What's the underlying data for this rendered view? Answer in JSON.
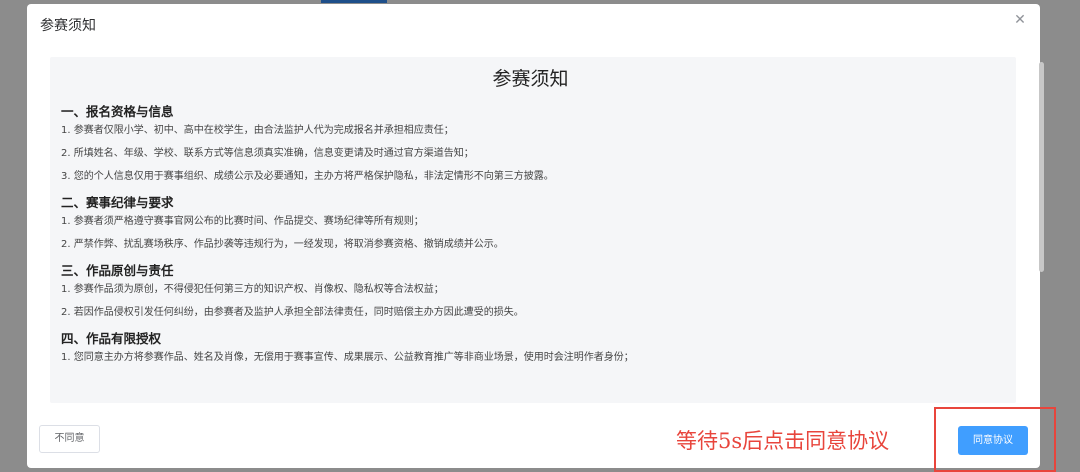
{
  "dialog": {
    "title": "参赛须知",
    "close_icon": "close-icon",
    "document": {
      "title": "参赛须知",
      "sections": [
        {
          "heading": "一、报名资格与信息",
          "items": [
            "1. 参赛者仅限小学、初中、高中在校学生，由合法监护人代为完成报名并承担相应责任；",
            "2. 所填姓名、年级、学校、联系方式等信息须真实准确，信息变更请及时通过官方渠道告知；",
            "3. 您的个人信息仅用于赛事组织、成绩公示及必要通知，主办方将严格保护隐私，非法定情形不向第三方披露。"
          ]
        },
        {
          "heading": "二、赛事纪律与要求",
          "items": [
            "1. 参赛者须严格遵守赛事官网公布的比赛时间、作品提交、赛场纪律等所有规则；",
            "2. 严禁作弊、扰乱赛场秩序、作品抄袭等违规行为，一经发现，将取消参赛资格、撤销成绩并公示。"
          ]
        },
        {
          "heading": "三、作品原创与责任",
          "items": [
            "1. 参赛作品须为原创，不得侵犯任何第三方的知识产权、肖像权、隐私权等合法权益；",
            "2. 若因作品侵权引发任何纠纷，由参赛者及监护人承担全部法律责任，同时赔偿主办方因此遭受的损失。"
          ]
        },
        {
          "heading": "四、作品有限授权",
          "items": [
            "1. 您同意主办方将参赛作品、姓名及肖像，无偿用于赛事宣传、成果展示、公益教育推广等非商业场景，使用时会注明作者身份；"
          ]
        }
      ]
    },
    "buttons": {
      "disagree": "不同意",
      "agree": "同意协议"
    }
  },
  "annotation": {
    "hint": "等待5s后点击同意协议",
    "color": "#e8453c"
  },
  "colors": {
    "primary": "#409eff",
    "overlay": "#8c8c8c"
  }
}
